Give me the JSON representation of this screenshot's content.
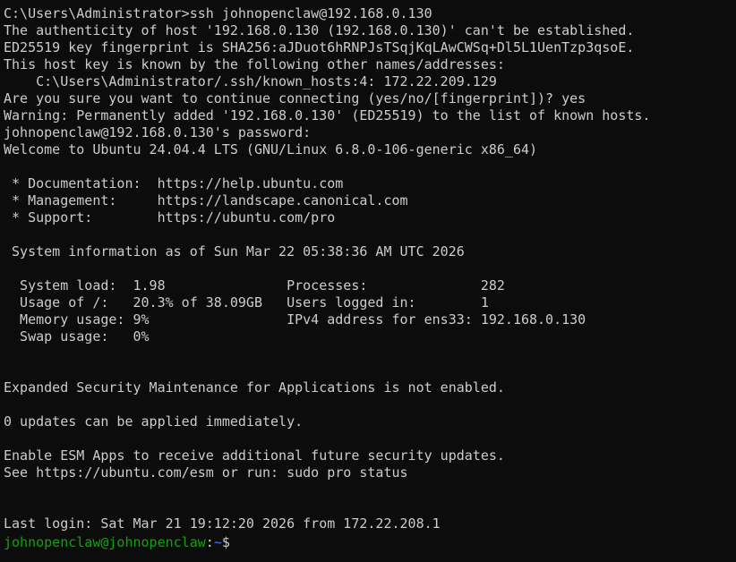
{
  "colors": {
    "background": "#0c0c0c",
    "foreground": "#cccccc",
    "prompt_user_host": "#13a10e",
    "prompt_path": "#3b78ff"
  },
  "lines": [
    "C:\\Users\\Administrator>ssh johnopenclaw@192.168.0.130",
    "The authenticity of host '192.168.0.130 (192.168.0.130)' can't be established.",
    "ED25519 key fingerprint is SHA256:aJDuot6hRNPJsTSqjKqLAwCWSq+Dl5L1UenTzp3qsoE.",
    "This host key is known by the following other names/addresses:",
    "    C:\\Users\\Administrator/.ssh/known_hosts:4: 172.22.209.129",
    "Are you sure you want to continue connecting (yes/no/[fingerprint])? yes",
    "Warning: Permanently added '192.168.0.130' (ED25519) to the list of known hosts.",
    "johnopenclaw@192.168.0.130's password:",
    "Welcome to Ubuntu 24.04.4 LTS (GNU/Linux 6.8.0-106-generic x86_64)",
    "",
    " * Documentation:  https://help.ubuntu.com",
    " * Management:     https://landscape.canonical.com",
    " * Support:        https://ubuntu.com/pro",
    "",
    " System information as of Sun Mar 22 05:38:36 AM UTC 2026",
    "",
    "  System load:  1.98               Processes:              282",
    "  Usage of /:   20.3% of 38.09GB   Users logged in:        1",
    "  Memory usage: 9%                 IPv4 address for ens33: 192.168.0.130",
    "  Swap usage:   0%",
    "",
    "",
    "Expanded Security Maintenance for Applications is not enabled.",
    "",
    "0 updates can be applied immediately.",
    "",
    "Enable ESM Apps to receive additional future security updates.",
    "See https://ubuntu.com/esm or run: sudo pro status",
    "",
    "",
    "Last login: Sat Mar 21 19:12:20 2026 from 172.22.208.1"
  ],
  "prompt": {
    "user_host": "johnopenclaw@johnopenclaw",
    "colon": ":",
    "path": "~",
    "symbol": "$"
  }
}
